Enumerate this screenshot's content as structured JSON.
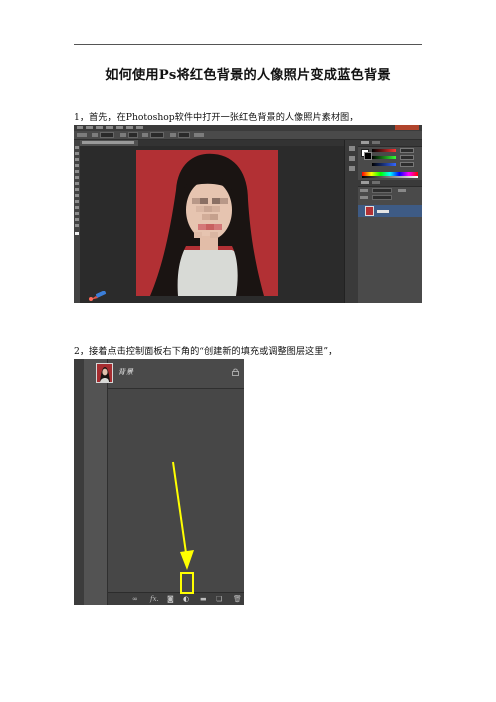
{
  "document": {
    "title": "如何使用Ps将红色背景的人像照片变成蓝色背景",
    "steps": [
      {
        "text": "1，首先，在Photoshop软件中打开一张红色背景的人像照片素材图，"
      },
      {
        "text": "2，接着点击控制面板右下角的“创建新的填充或调整图层这里”，"
      }
    ]
  },
  "screenshot2": {
    "layer_name": "背景",
    "bottom_icons": [
      "link-icon",
      "fx-icon",
      "mask-icon",
      "adjustment-layer-icon",
      "group-icon",
      "new-layer-icon",
      "trash-icon"
    ],
    "fx_label": "fx."
  },
  "colors": {
    "photo_background": "#b23034",
    "highlight": "#ffff00",
    "ps_panel": "#4a4a4a",
    "selected_layer": "#3e5b85"
  }
}
